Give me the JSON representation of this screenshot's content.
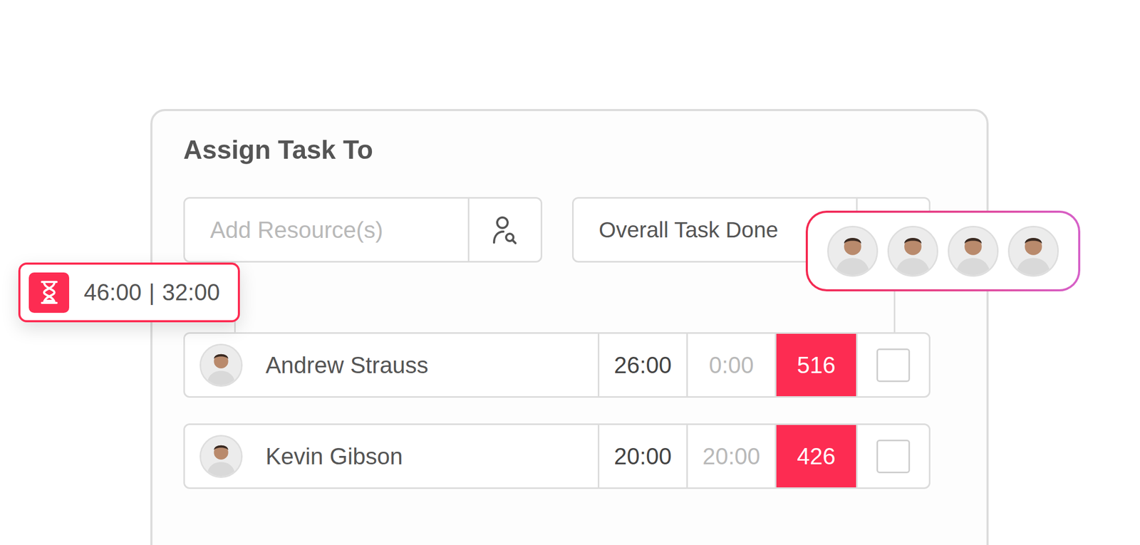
{
  "title": "Assign Task To",
  "search": {
    "placeholder": "Add Resource(s)"
  },
  "overall": {
    "label": "Overall Task Done"
  },
  "timer": {
    "estimated": "46:00",
    "separator": "|",
    "spent": "32:00"
  },
  "avatar_group": [
    {
      "kind": "photo"
    },
    {
      "kind": "photo"
    },
    {
      "kind": "photo"
    },
    {
      "kind": "photo"
    }
  ],
  "rows": [
    {
      "name": "Andrew Strauss",
      "planned": "26:00",
      "actual": "0:00",
      "count": "516",
      "checked": false
    },
    {
      "name": "Kevin Gibson",
      "planned": "20:00",
      "actual": "20:00",
      "count": "426",
      "checked": false
    }
  ]
}
